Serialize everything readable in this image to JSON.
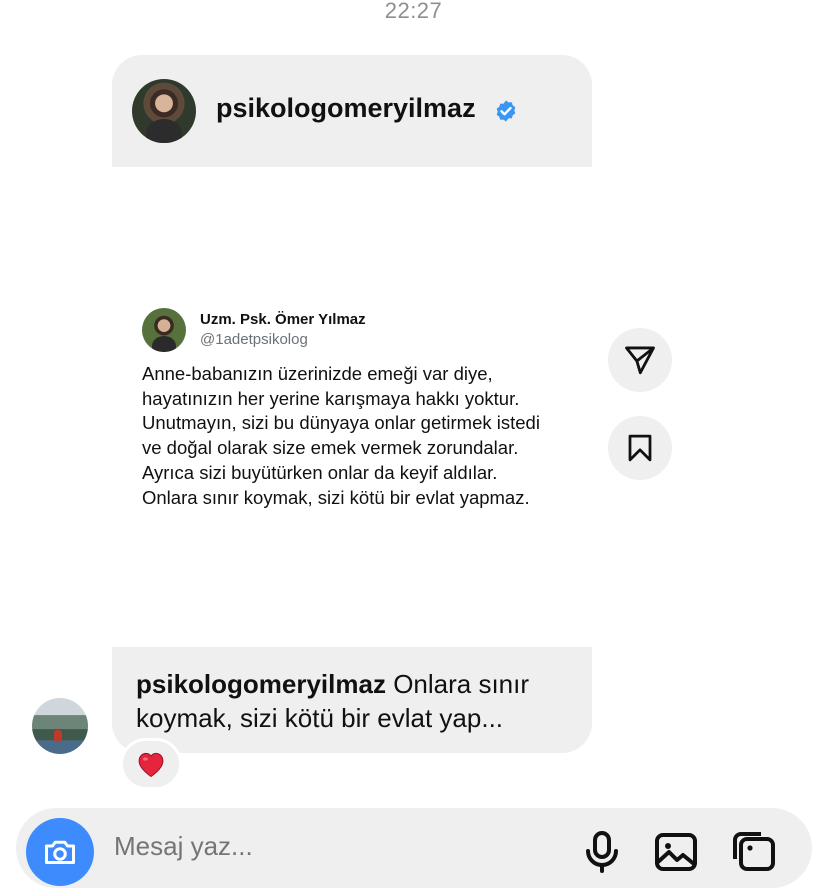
{
  "timestamp": "22:27",
  "shared_post": {
    "author_username": "psikologomeryilmaz",
    "verified": true,
    "verified_color": "#3897f0",
    "tweet": {
      "display_name": "Uzm. Psk. Ömer Yılmaz",
      "handle": "@1adetpsikolog",
      "lines": [
        "Anne-babanızın üzerinizde emeği var diye,",
        "hayatınızın her yerine karışmaya hakkı yoktur.",
        "Unutmayın, sizi bu dünyaya onlar getirmek istedi",
        "ve doğal olarak size emek vermek zorundalar.",
        "Ayrıca sizi buyütürken onlar da keyif aldılar.",
        "Onlara sınır koymak, sizi kötü bir evlat yapmaz."
      ]
    }
  },
  "actions": {
    "share_icon": "send-icon",
    "save_icon": "bookmark-icon"
  },
  "reply_bubble": {
    "username": "psikologomeryilmaz",
    "text": " Onlara sınır koymak, sizi kötü bir evlat yap..."
  },
  "reaction": {
    "emoji": "❤️"
  },
  "composer": {
    "placeholder": "Mesaj yaz...",
    "camera_color": "#3d8bfd",
    "icons": [
      "microphone-icon",
      "image-icon",
      "sticker-icon"
    ]
  }
}
